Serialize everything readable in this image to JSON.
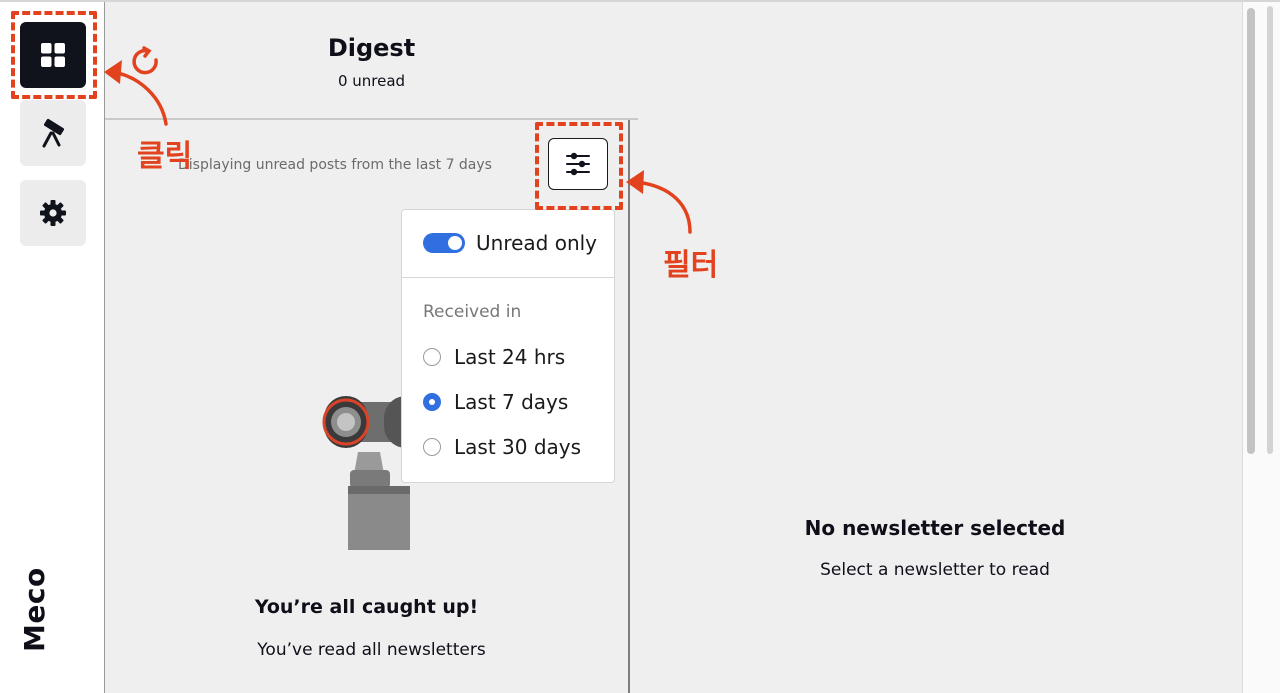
{
  "sidebar": {
    "items": [
      {
        "name": "digest",
        "icon": "grid-icon",
        "active": true
      },
      {
        "name": "discover",
        "icon": "telescope-icon",
        "active": false
      },
      {
        "name": "settings",
        "icon": "gear-icon",
        "active": false
      }
    ],
    "brand": "Meco"
  },
  "digest": {
    "title": "Digest",
    "unread": "0 unread",
    "filter_note": "Displaying unread posts from the last 7 days",
    "filter_button_icon": "sliders-icon"
  },
  "filter_menu": {
    "toggle_label": "Unread only",
    "toggle_on": true,
    "section_label": "Received in",
    "options": [
      {
        "label": "Last 24 hrs",
        "checked": false
      },
      {
        "label": "Last 7 days",
        "checked": true
      },
      {
        "label": "Last 30 days",
        "checked": false
      }
    ]
  },
  "empty_state": {
    "title": "You’re all caught up!",
    "subtitle": "You’ve read all newsletters",
    "illustration": "binoculars-illustration"
  },
  "reader": {
    "title": "No newsletter selected",
    "subtitle": "Select a newsletter to read"
  },
  "annotations": {
    "click_label": "클릭",
    "filter_label": "필터",
    "color": "#e2431e"
  },
  "colors": {
    "accent": "#2f6fe0",
    "active_nav": "#10131c"
  }
}
